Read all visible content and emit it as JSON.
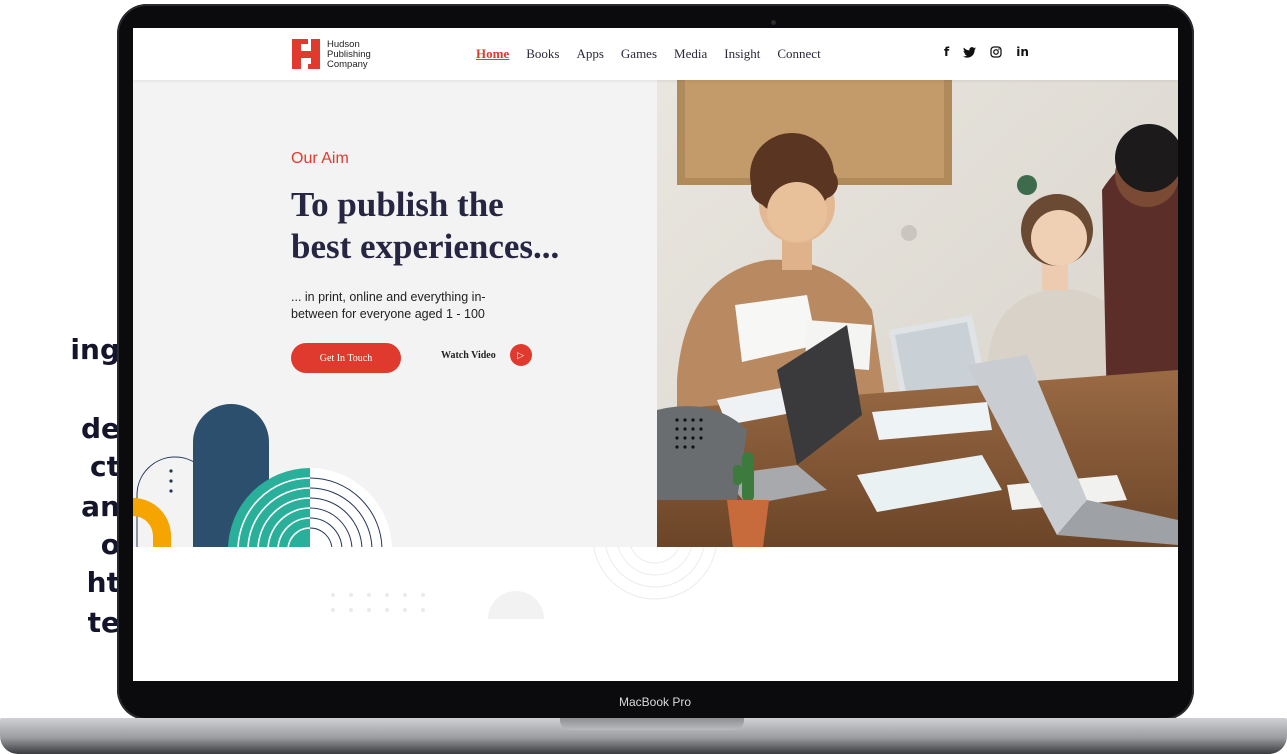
{
  "side_text": [
    "ing",
    "de",
    "ct",
    "an",
    "o",
    "ht",
    "te"
  ],
  "laptop": {
    "brand_label": "MacBook Pro"
  },
  "site": {
    "logo": {
      "mark": "H",
      "line1": "Hudson",
      "line2": "Publishing",
      "line3": "Company"
    },
    "nav": [
      {
        "label": "Home",
        "active": true
      },
      {
        "label": "Books"
      },
      {
        "label": "Apps"
      },
      {
        "label": "Games"
      },
      {
        "label": "Media"
      },
      {
        "label": "Insight"
      },
      {
        "label": "Connect"
      }
    ],
    "social": {
      "facebook": "f",
      "twitter": "🐦",
      "instagram": "◎",
      "linkedin": "in"
    }
  },
  "hero": {
    "eyebrow": "Our Aim",
    "headline_line1": "To publish the",
    "headline_line2": "best experiences...",
    "subtext_line1": "... in print, online and everything in-",
    "subtext_line2": "between for everyone aged 1 - 100",
    "cta_primary": "Get In Touch",
    "cta_secondary": "Watch Video",
    "play_icon": "▷"
  },
  "colors": {
    "accent": "#e03a2f",
    "navy": "#262642",
    "teal": "#2ab09a",
    "orange": "#f5a400",
    "slate_blue": "#2c4f6e"
  }
}
